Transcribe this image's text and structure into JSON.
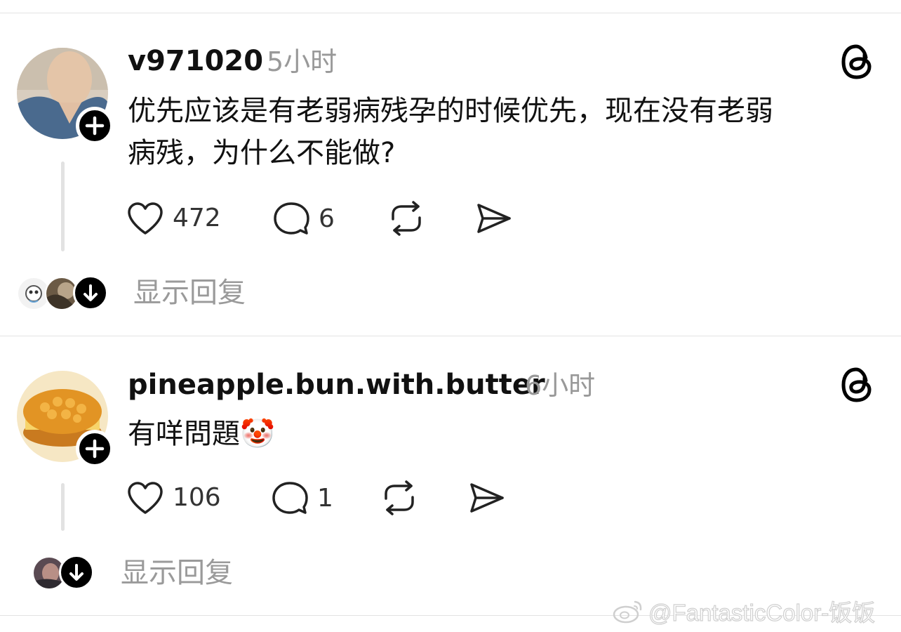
{
  "posts": [
    {
      "username": "v971020",
      "timestamp": "5小时",
      "text_lines": [
        "优先应该是有老弱病残孕的时候优先，现在没有老弱",
        "病残，为什么不能做?"
      ],
      "likes": "472",
      "comments": "6",
      "show_replies_label": "显示回复"
    },
    {
      "username": "pineapple.bun.with.butter",
      "timestamp": "6小时",
      "text_lines": [
        "有咩問題🤡"
      ],
      "likes": "106",
      "comments": "1",
      "show_replies_label": "显示回复"
    }
  ],
  "icons": {
    "follow": "plus-icon",
    "platform": "threads-logo-icon",
    "like": "heart-icon",
    "comment": "comment-bubble-icon",
    "repost": "repost-icon",
    "share": "send-icon",
    "expand": "arrow-down-icon"
  },
  "watermark": {
    "text": "@FantasticColor-饭饭"
  },
  "colors": {
    "text": "#111111",
    "secondary": "#999999",
    "divider": "#e3e3e3",
    "accent": "#000000"
  }
}
